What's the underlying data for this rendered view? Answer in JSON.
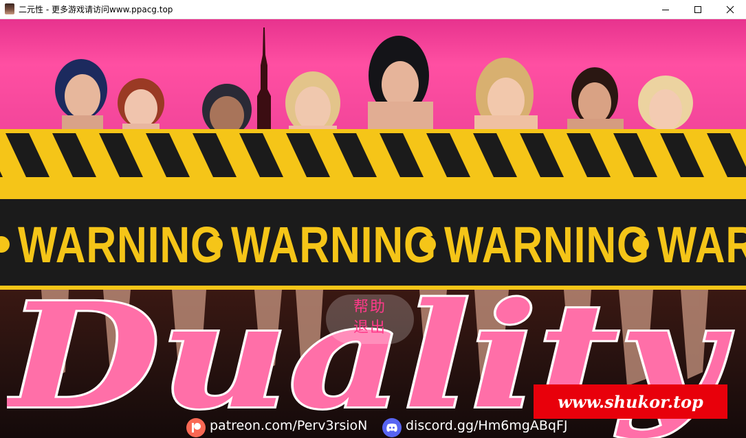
{
  "window": {
    "title": "二元性 - 更多游戏请访问www.ppacg.top",
    "icon": "app-portrait-icon",
    "controls": [
      "minimize-icon",
      "maximize-icon",
      "close-icon"
    ]
  },
  "game": {
    "tape_word": "WARNING",
    "logo_text": "Duality",
    "menu": {
      "help_label": "帮助",
      "exit_label": "退出"
    },
    "watermark": "www.shukor.top",
    "links": {
      "patreon": "patreon.com/Perv3rsioN",
      "discord": "discord.gg/Hm6mgABqFJ"
    }
  },
  "colors": {
    "pink_background": "#ff4fa2",
    "tape_yellow": "#f5c518",
    "tape_black": "#1b1b1b",
    "logo_pink": "#ff6fa8",
    "menu_text": "#ff3a8a",
    "watermark_red": "#e8000b",
    "patreon_orange": "#f96854",
    "discord_blue": "#5865f2"
  }
}
